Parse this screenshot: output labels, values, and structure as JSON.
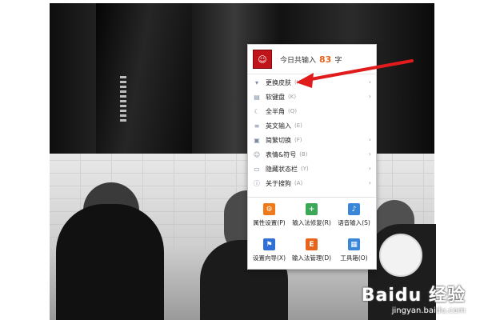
{
  "header": {
    "text": "今日共输入",
    "count": "83",
    "unit": "字"
  },
  "menu_items": [
    {
      "label": "更换皮肤",
      "key": "(H)",
      "icon": "shirt-icon",
      "submenu": true
    },
    {
      "label": "软键盘",
      "key": "(K)",
      "icon": "keyboard-icon",
      "submenu": true
    },
    {
      "label": "全半角",
      "key": "(Q)",
      "icon": "moon-icon",
      "submenu": false
    },
    {
      "label": "英文输入",
      "key": "(E)",
      "icon": "text-icon",
      "submenu": false
    },
    {
      "label": "简繁切换",
      "key": "(F)",
      "icon": "convert-icon",
      "submenu": true
    },
    {
      "label": "表情&符号",
      "key": "(B)",
      "icon": "smiley-icon",
      "submenu": true
    },
    {
      "label": "隐藏状态栏",
      "key": "(Y)",
      "icon": "hide-bar-icon",
      "submenu": true
    },
    {
      "label": "关于搜狗",
      "key": "(A)",
      "icon": "info-icon",
      "submenu": true
    }
  ],
  "tools": [
    {
      "label": "属性设置",
      "key": "(P)",
      "icon": "gear-icon",
      "color": "#f07a1a",
      "glyph": "⚙"
    },
    {
      "label": "输入法修复",
      "key": "(R)",
      "icon": "toolbox-icon",
      "color": "#3aa857",
      "glyph": "+"
    },
    {
      "label": "语音输入",
      "key": "(S)",
      "icon": "microphone-icon",
      "color": "#3a86d8",
      "glyph": "♪"
    },
    {
      "label": "设置向导",
      "key": "(X)",
      "icon": "flag-icon",
      "color": "#2f6fd6",
      "glyph": "⚑"
    },
    {
      "label": "输入法管理",
      "key": "(D)",
      "icon": "manage-icon",
      "color": "#e8641b",
      "glyph": "E"
    },
    {
      "label": "工具箱",
      "key": "(O)",
      "icon": "grid-icon",
      "color": "#3a86d8",
      "glyph": "▦"
    }
  ],
  "watermark": {
    "brand": "Baidu 经验",
    "site": "jingyan.baidu.com"
  },
  "colors": {
    "arrow": "#e01b1b",
    "count": "#e8641b",
    "avatar": "#c0141a"
  }
}
